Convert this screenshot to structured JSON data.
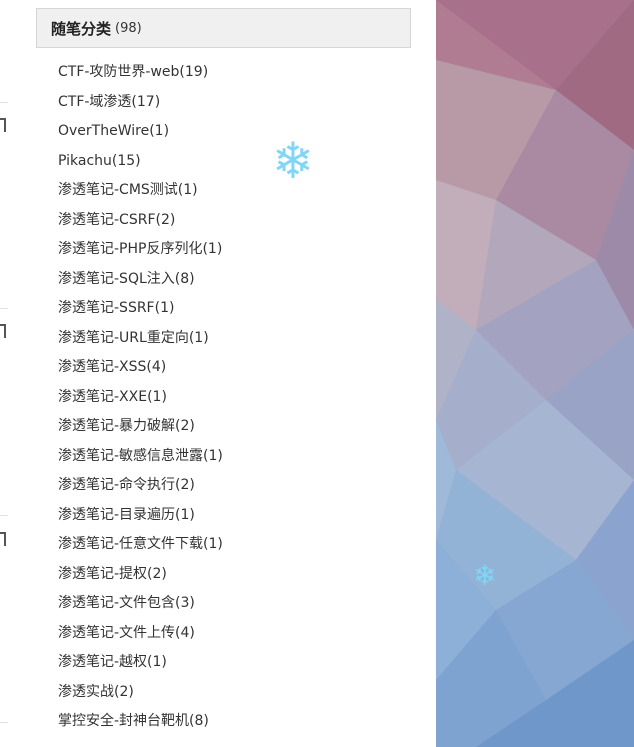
{
  "sidebar": {
    "title": "随笔分类",
    "count": "(98)",
    "items": [
      {
        "label": "CTF-攻防世界-web(19)"
      },
      {
        "label": "CTF-域渗透(17)"
      },
      {
        "label": "OverTheWire(1)"
      },
      {
        "label": "Pikachu(15)"
      },
      {
        "label": "渗透笔记-CMS测试(1)"
      },
      {
        "label": "渗透笔记-CSRF(2)"
      },
      {
        "label": "渗透笔记-PHP反序列化(1)"
      },
      {
        "label": "渗透笔记-SQL注入(8)"
      },
      {
        "label": "渗透笔记-SSRF(1)"
      },
      {
        "label": "渗透笔记-URL重定向(1)"
      },
      {
        "label": "渗透笔记-XSS(4)"
      },
      {
        "label": "渗透笔记-XXE(1)"
      },
      {
        "label": "渗透笔记-暴力破解(2)"
      },
      {
        "label": "渗透笔记-敏感信息泄露(1)"
      },
      {
        "label": "渗透笔记-命令执行(2)"
      },
      {
        "label": "渗透笔记-目录遍历(1)"
      },
      {
        "label": "渗透笔记-任意文件下载(1)"
      },
      {
        "label": "渗透笔记-提权(2)"
      },
      {
        "label": "渗透笔记-文件包含(3)"
      },
      {
        "label": "渗透笔记-文件上传(4)"
      },
      {
        "label": "渗透笔记-越权(1)"
      },
      {
        "label": "渗透实战(2)"
      },
      {
        "label": "掌控安全-封神台靶机(8)"
      }
    ]
  },
  "decor": {
    "snowflake_glyph": "❄",
    "snowflake_color": "#7fd6f5",
    "background_palette": [
      "#a86f86",
      "#b48a98",
      "#9e9bb8",
      "#8fa8cc",
      "#7d9fcf",
      "#6f95c8"
    ]
  }
}
